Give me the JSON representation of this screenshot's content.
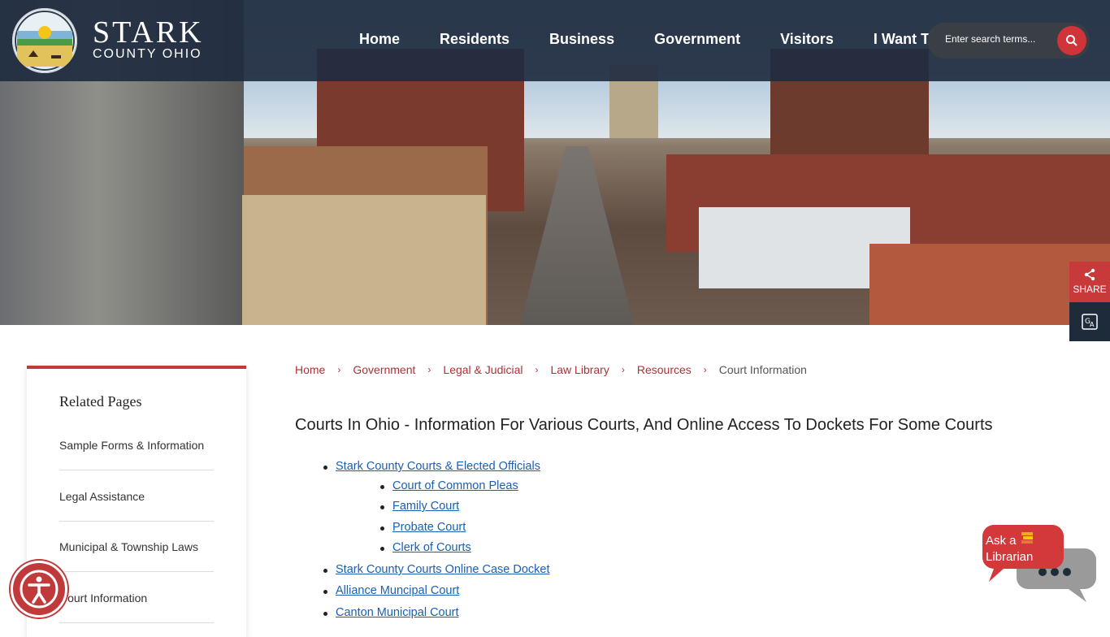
{
  "header": {
    "logo_title": "STARK",
    "logo_subtitle": "COUNTY OHIO",
    "nav": [
      "Home",
      "Residents",
      "Business",
      "Government",
      "Visitors",
      "I Want To"
    ],
    "search_placeholder": "Enter search terms..."
  },
  "share_label": "SHARE",
  "sidebar": {
    "title": "Related Pages",
    "items": [
      "Sample Forms & Information",
      "Legal Assistance",
      "Municipal & Township Laws",
      "Court Information"
    ]
  },
  "breadcrumb": {
    "items": [
      "Home",
      "Government",
      "Legal & Judicial",
      "Law Library",
      "Resources"
    ],
    "current": "Court Information"
  },
  "main": {
    "title": "Courts In Ohio - Information For Various Courts, And Online Access To Dockets For Some Courts",
    "links": [
      "Stark County Courts & Elected Officials",
      "Court of Common Pleas",
      "Family Court",
      "Probate Court",
      "Clerk of Courts",
      "Stark County Courts Online Case Docket",
      "Alliance Muncipal Court",
      "Canton Municipal Court"
    ]
  },
  "chat": {
    "line1": "Ask a",
    "line2": "Librarian"
  },
  "colors": {
    "header_bg": "#202c40",
    "accent_red": "#c0393b",
    "link_blue": "#1a5fb4"
  }
}
